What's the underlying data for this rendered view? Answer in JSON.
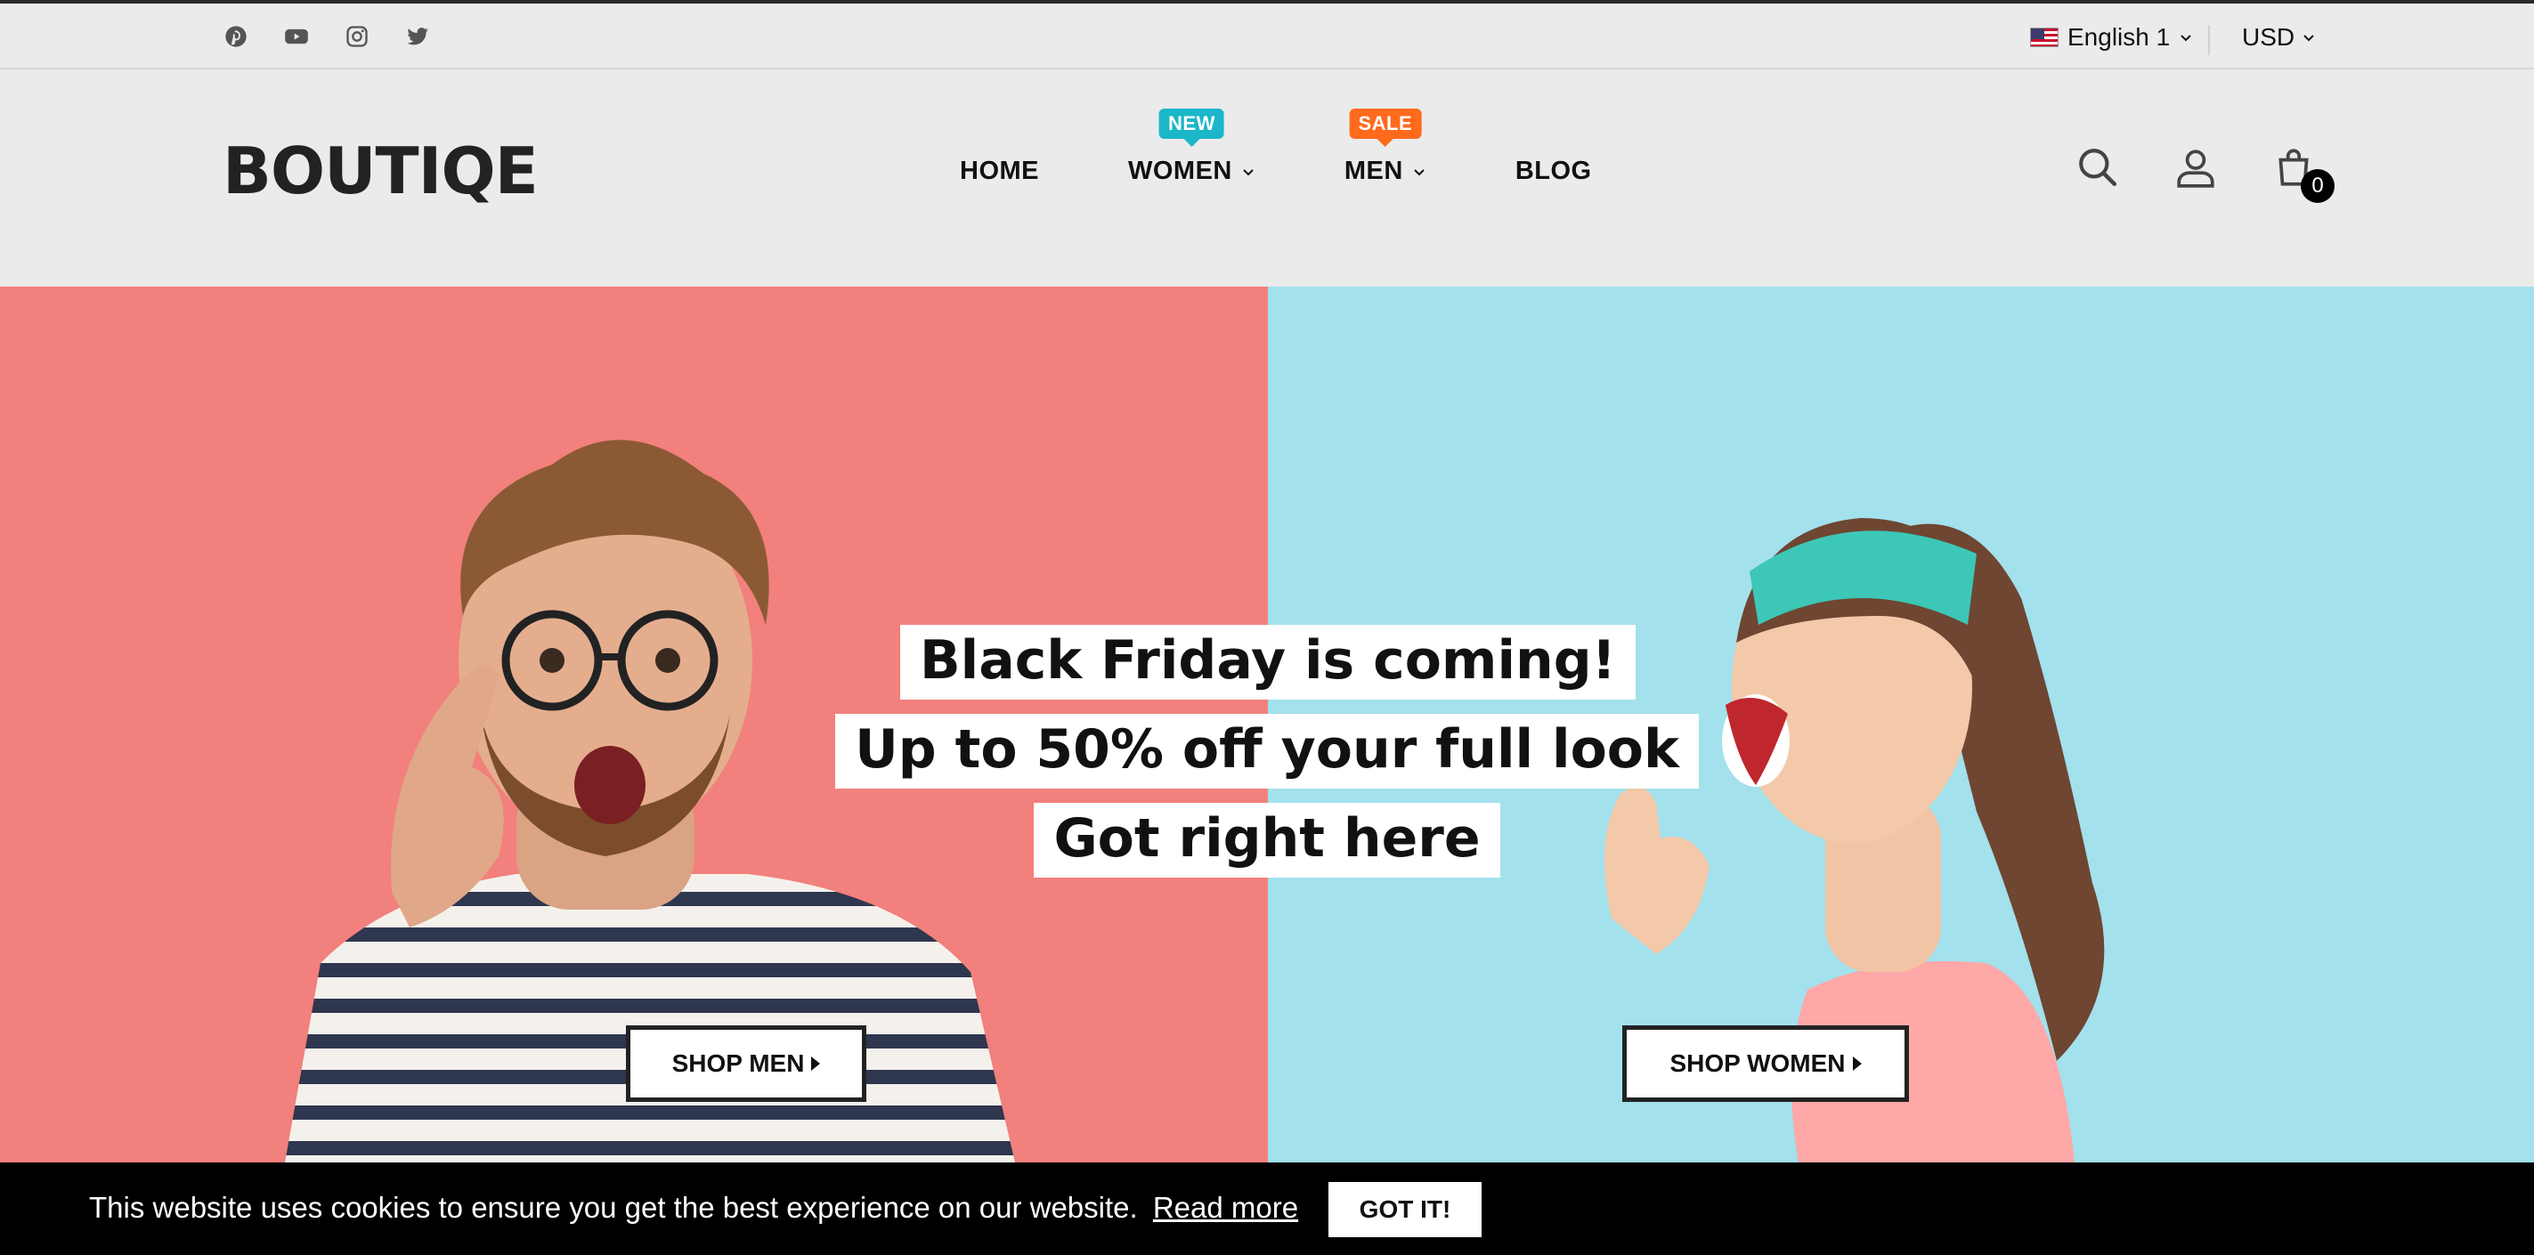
{
  "topbar": {
    "social_icons": [
      "pinterest-icon",
      "youtube-icon",
      "instagram-icon",
      "twitter-icon"
    ],
    "language": "English 1",
    "currency": "USD"
  },
  "header": {
    "logo": "BOUTIQE",
    "nav": [
      {
        "label": "HOME"
      },
      {
        "label": "WOMEN",
        "badge": "NEW",
        "badge_color": "#1cb6c9"
      },
      {
        "label": "MEN",
        "badge": "SALE",
        "badge_color": "#ff6a1c"
      },
      {
        "label": "BLOG"
      }
    ],
    "cart_count": "0"
  },
  "hero": {
    "headline": [
      "Black Friday is coming!",
      "Up to 50% off your full look",
      "Got right here"
    ],
    "shop_men": "SHOP MEN",
    "shop_women": "SHOP WOMEN",
    "colors": {
      "left_bg": "#f2807c",
      "right_bg": "#a3e1ec"
    }
  },
  "cookie": {
    "text": "This website uses cookies to ensure you get the best experience on our website.",
    "link": "Read more",
    "button": "GOT IT!"
  }
}
